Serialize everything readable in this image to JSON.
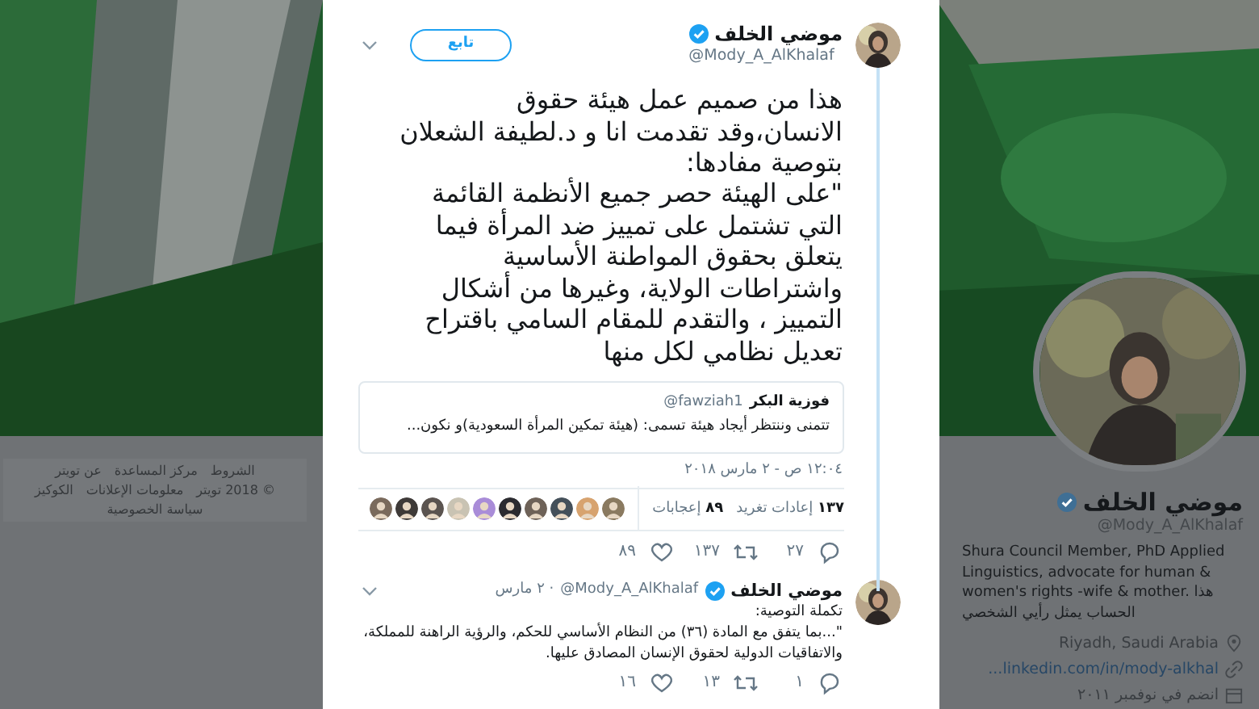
{
  "profile": {
    "name": "موضي الخلف",
    "verified": true,
    "handle": "@Mody_A_AlKhalaf",
    "bio": "Shura Council Member, PhD Applied Linguistics, advocate for human & women's rights -wife & mother. هذا الحساب يمثل رأيي الشخصي",
    "location": "Riyadh, Saudi Arabia",
    "link": "...linkedin.com/in/mody-alkhal",
    "joined": "انضم في نوفمبر ٢٠١١"
  },
  "footer_links": [
    "الشروط",
    "مركز المساعدة",
    "عن تويتر",
    "© 2018 تويتر",
    "معلومات الإعلانات",
    "الكوكيز",
    "سياسة الخصوصية"
  ],
  "tweet": {
    "name": "موضي الخلف",
    "verified": true,
    "handle": "@Mody_A_AlKhalaf",
    "follow_label": "تابع",
    "text_lines": [
      "هذا من صميم عمل هيئة حقوق",
      "الانسان،وقد تقدمت انا و د.لطيفة الشعلان",
      "بتوصية مفادها:",
      "\"على الهيئة حصر جميع الأنظمة القائمة",
      "التي تشتمل على تمييز ضد المرأة فيما",
      "يتعلق بحقوق المواطنة الأساسية",
      "واشتراطات الولاية، وغيرها من أشكال",
      "التمييز ، والتقدم للمقام السامي باقتراح",
      "تعديل نظامي لكل منها"
    ],
    "quoted": {
      "name": "فوزية البكر",
      "handle": "@fawziah1",
      "text": "تتمنى  وننتظر أيجاد هيئة تسمى: (هيئة تمكين المرأة السعودية)و نكون..."
    },
    "timestamp": "١٢:٠٤ ص - ٢ مارس ٢٠١٨",
    "retweets_count": "١٣٧",
    "retweets_label": "إعادات تغريد",
    "likes_count": "٨٩",
    "likes_label": "إعجابات",
    "liked_by": [
      {
        "kind": "picture"
      },
      {
        "kind": "picture"
      },
      {
        "kind": "picture"
      },
      {
        "kind": "picture"
      },
      {
        "kind": "picture"
      },
      {
        "kind": "picture"
      },
      {
        "kind": "picture"
      },
      {
        "kind": "picture"
      },
      {
        "kind": "picture"
      },
      {
        "kind": "picture"
      }
    ],
    "actions": [
      {
        "kind": "reply",
        "count": "٢٧"
      },
      {
        "kind": "retweet",
        "count": "١٣٧"
      },
      {
        "kind": "like",
        "count": "٨٩"
      }
    ]
  },
  "reply": {
    "name": "موضي الخلف",
    "verified": true,
    "handle": "@Mody_A_AlKhalaf",
    "date": "· ٢ مارس",
    "text_lines": [
      "تكملة التوصية:",
      "\"...بما يتفق مع المادة (٣٦) من النظام الأساسي للحكم، والرؤية الراهنة للمملكة،",
      "والاتفاقيات الدولية لحقوق الإنسان المصادق عليها."
    ],
    "actions": [
      {
        "kind": "reply",
        "count": "١"
      },
      {
        "kind": "retweet",
        "count": "١٣"
      },
      {
        "kind": "like",
        "count": "١٦"
      }
    ]
  }
}
